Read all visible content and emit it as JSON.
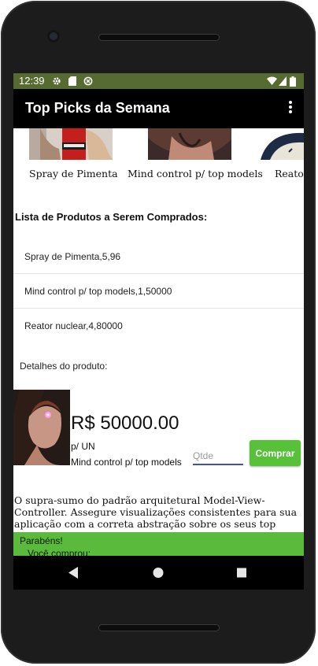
{
  "status_bar": {
    "time": "12:39",
    "background": "#556b2f"
  },
  "app_bar": {
    "title": "Top Picks da Semana",
    "menu_icon": "more-vert-icon"
  },
  "carousel": {
    "items": [
      {
        "label": "Spray de Pimenta",
        "image": "pepper-spray-photo"
      },
      {
        "label": "Mind control p/ top models",
        "image": "model-photo"
      },
      {
        "label": "Reator nuclear",
        "image": "reactor-photo"
      }
    ]
  },
  "purchase_list": {
    "title": "Lista de Produtos a Serem Comprados:",
    "items": [
      "Spray de Pimenta,5,96",
      "Mind control p/ top models,1,50000",
      "Reator nuclear,4,80000"
    ]
  },
  "details": {
    "label": "Detalhes do produto:",
    "price": "R$ 50000.00",
    "unit": "p/ UN",
    "product_name": "Mind control p/ top models",
    "quantity_placeholder": "Qtde",
    "buy_label": "Comprar",
    "buy_color": "#58c13a",
    "description": "O supra-sumo do padrão arquitetural Model-View-Controller. Assegure visualizações consistentes para sua aplicação com a correta abstração sobre os seus top models."
  },
  "toast": {
    "line1": "Parabéns!",
    "line2": "Você comprou:",
    "background": "#5aba3c"
  },
  "nav_bar": {
    "back": "back-icon",
    "home": "home-icon",
    "recents": "recents-icon"
  }
}
